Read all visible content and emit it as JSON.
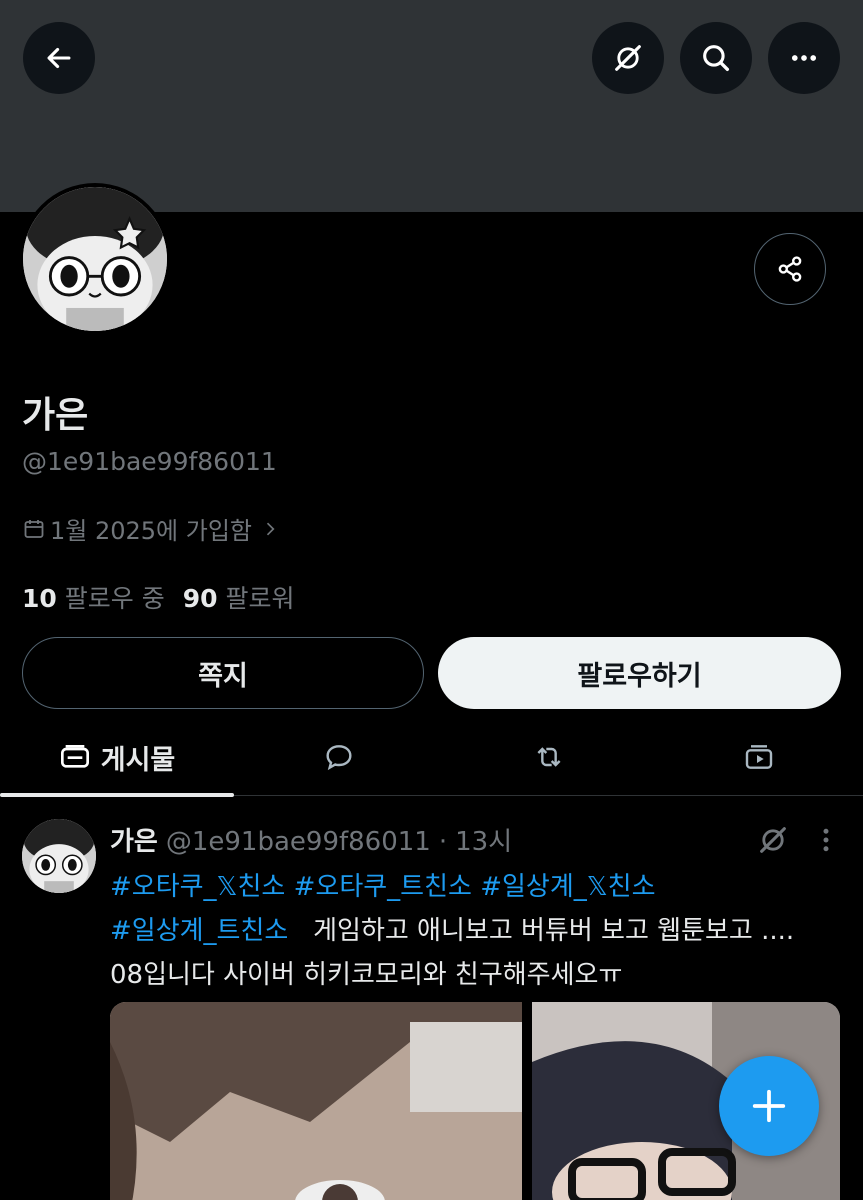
{
  "header": {
    "back_icon": "arrow-left-icon",
    "grok_icon": "grok-icon",
    "search_icon": "search-icon",
    "more_icon": "more-horizontal-icon"
  },
  "profile": {
    "display_name": "가은",
    "handle": "@1e91bae99f86011",
    "joined": "1월 2025에 가입함",
    "following_count": "10",
    "following_label": "팔로우 중",
    "followers_count": "90",
    "followers_label": "팔로워",
    "share_icon": "share-icon"
  },
  "actions": {
    "message_label": "쪽지",
    "follow_label": "팔로우하기"
  },
  "tabs": [
    {
      "label": "게시물",
      "icon": "posts-icon",
      "active": true
    },
    {
      "label": "",
      "icon": "replies-icon",
      "active": false
    },
    {
      "label": "",
      "icon": "reposts-icon",
      "active": false
    },
    {
      "label": "",
      "icon": "media-icon",
      "active": false
    }
  ],
  "post": {
    "name": "가은",
    "handle": "@1e91bae99f86011",
    "separator": "·",
    "time": "13시",
    "hashtags": [
      "#오타쿠_𝕏친소",
      "#오타쿠_트친소",
      "#일상계_𝕏친소",
      "#일상계_트친소"
    ],
    "text_line1": "게임하고 애니보고 버튜버 보고 웹툰보고 ....",
    "text_line2": "08입니다 사이버 히키코모리와 친구해주세오ㅠ"
  },
  "fab": {
    "icon": "plus-icon"
  },
  "colors": {
    "background": "#000000",
    "banner": "#2f3336",
    "accent": "#1d9bf0",
    "text_primary": "#e7e9ea",
    "text_secondary": "#71767b"
  }
}
